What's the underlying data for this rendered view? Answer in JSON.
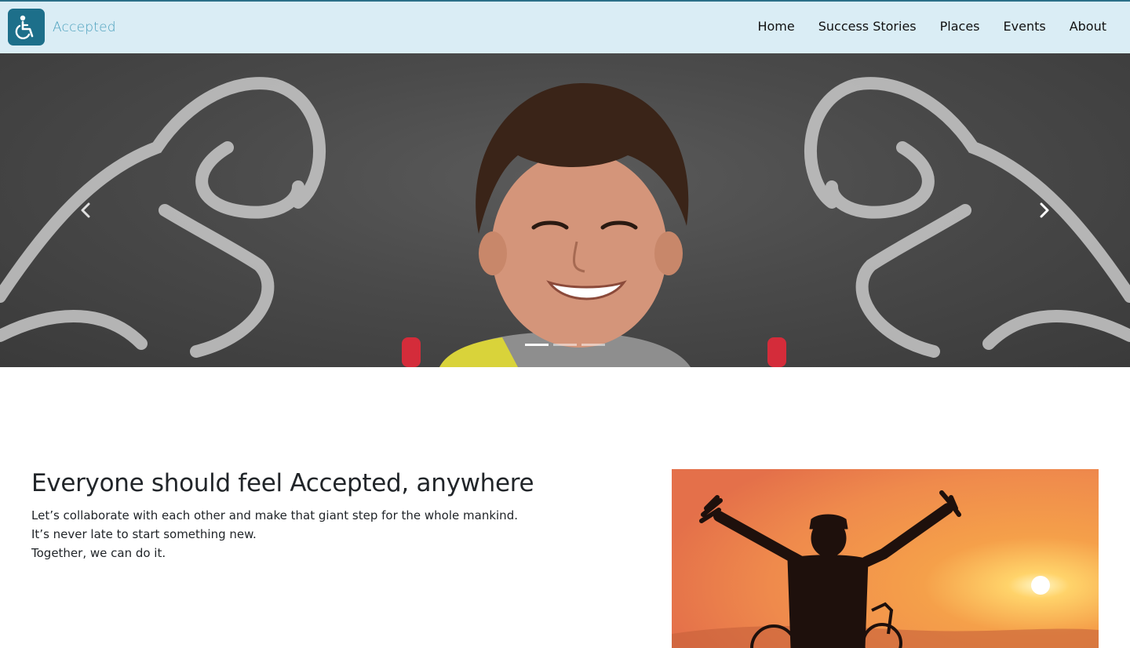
{
  "brand": {
    "name": "Accepted",
    "logo_icon": "wheelchair-icon",
    "logo_color": "#1d6f8a"
  },
  "nav": {
    "items": [
      {
        "label": "Home"
      },
      {
        "label": "Success Stories"
      },
      {
        "label": "Places"
      },
      {
        "label": "Events"
      },
      {
        "label": "About"
      }
    ]
  },
  "carousel": {
    "prev_icon": "chevron-left-icon",
    "next_icon": "chevron-right-icon",
    "slide_count": 3,
    "active_slide": 1
  },
  "intro": {
    "heading": "Everyone should feel Accepted, anywhere",
    "lines": [
      "Let’s collaborate with each other and make that giant step for the whole mankind.",
      "It’s never late to start something new.",
      "Together, we can do it."
    ]
  },
  "colors": {
    "navbar_bg": "#daedf5",
    "accent": "#1d6f8a",
    "brand_text": "#4aa0bd"
  }
}
